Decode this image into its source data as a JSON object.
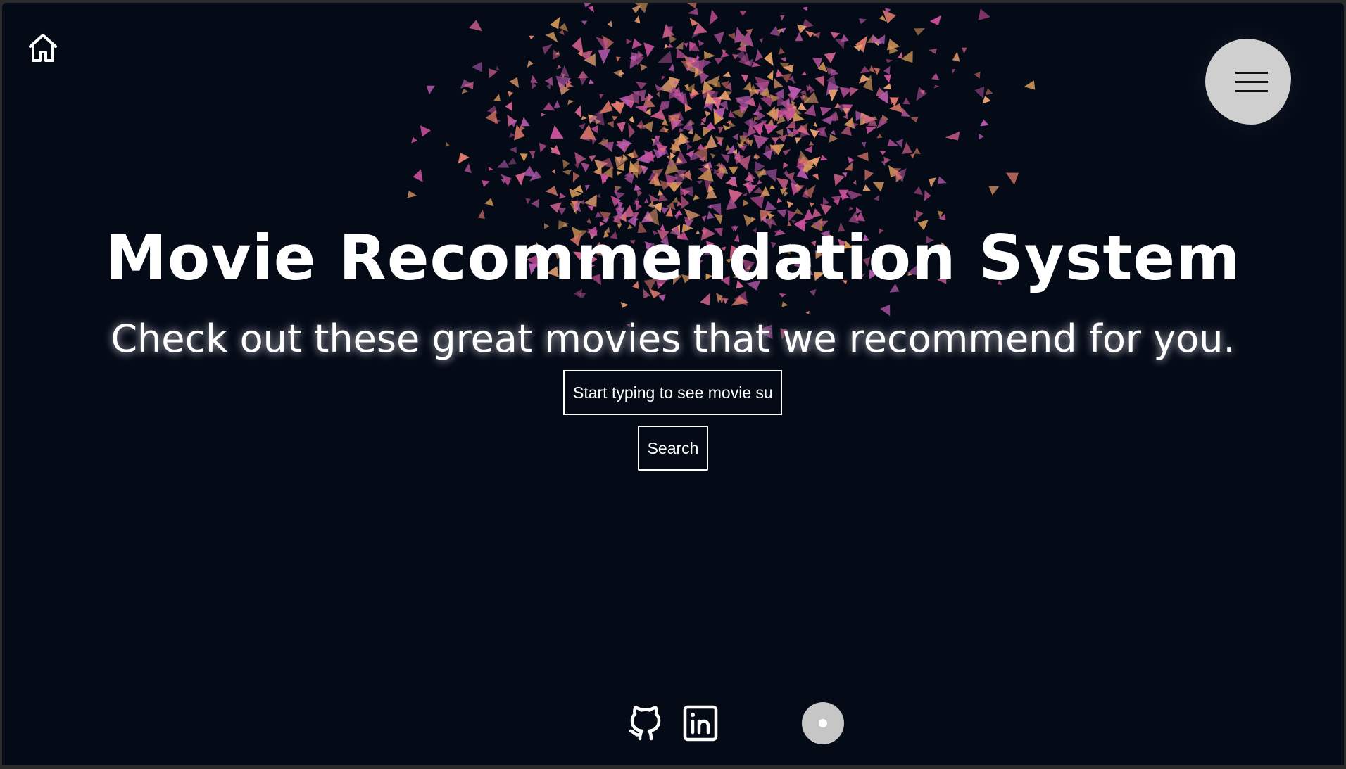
{
  "page": {
    "background": "#040a16",
    "accent": "#ffffff"
  },
  "nav": {
    "home_icon": "home-icon",
    "menu_icon": "hamburger-menu-icon"
  },
  "hero": {
    "title": "Movie Recommendation System",
    "subtitle": "Check out these great movies that we recommend for you."
  },
  "search": {
    "placeholder": "Start typing to see movie suggestions",
    "button_label": "Search"
  },
  "footer": {
    "links": [
      {
        "icon": "github-icon"
      },
      {
        "icon": "linkedin-icon"
      }
    ],
    "scroll_indicator_icon": "scroll-dot-icon"
  },
  "particles": {
    "colors": [
      "#c8509a",
      "#d0608c",
      "#e07a6a",
      "#b85ab0",
      "#d89a5a",
      "#a04a8a",
      "#e8a070"
    ]
  }
}
